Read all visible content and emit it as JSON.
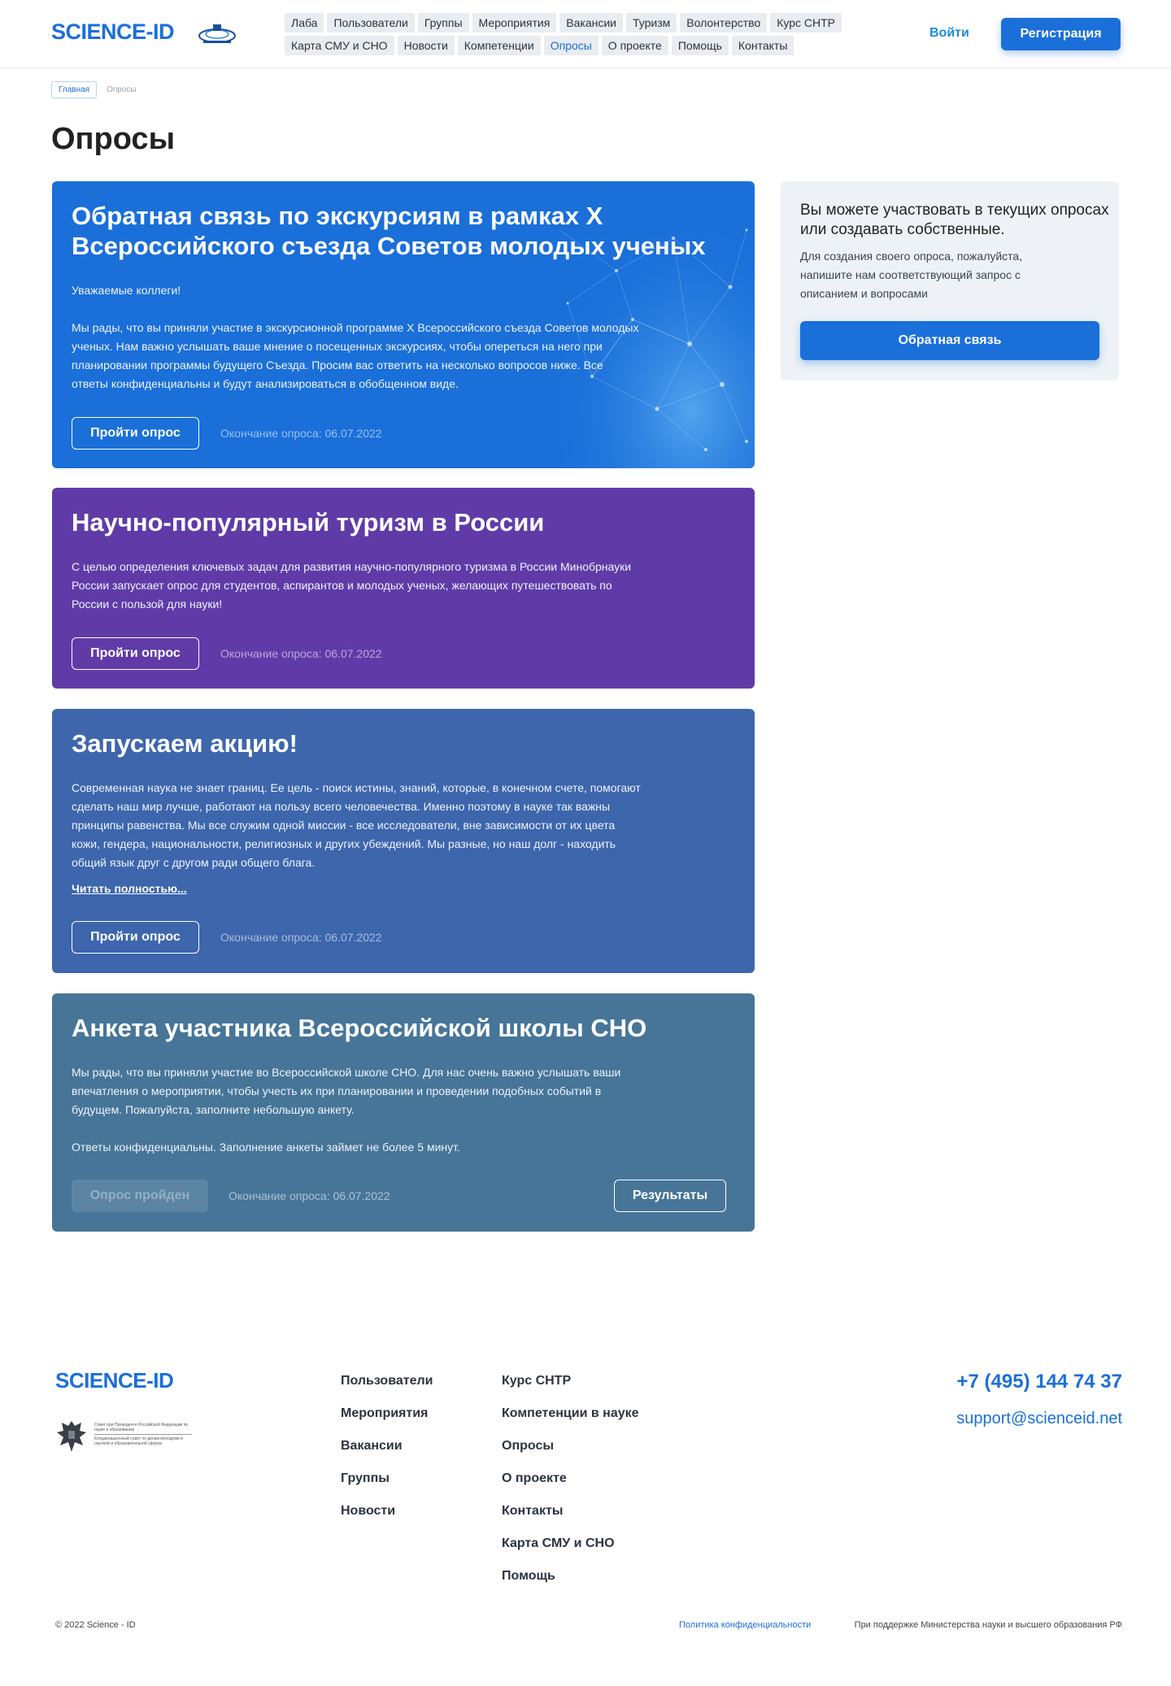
{
  "header": {
    "logo": "SCIENCE-ID",
    "nav": [
      {
        "label": "Лаба",
        "active": false
      },
      {
        "label": "Пользователи",
        "active": false
      },
      {
        "label": "Группы",
        "active": false
      },
      {
        "label": "Мероприятия",
        "active": false
      },
      {
        "label": "Вакансии",
        "active": false
      },
      {
        "label": "Туризм",
        "active": false
      },
      {
        "label": "Волонтерство",
        "active": false
      },
      {
        "label": "Курс СНТР",
        "active": false
      },
      {
        "label": "Карта СМУ и СНО",
        "active": false
      },
      {
        "label": "Новости",
        "active": false
      },
      {
        "label": "Компетенции",
        "active": false
      },
      {
        "label": "Опросы",
        "active": true
      },
      {
        "label": "О проекте",
        "active": false
      },
      {
        "label": "Помощь",
        "active": false
      },
      {
        "label": "Контакты",
        "active": false
      }
    ],
    "login": "Войти",
    "register": "Регистрация"
  },
  "breadcrumb": {
    "home": "Главная",
    "current": "Опросы"
  },
  "page_title": "Опросы",
  "polls": [
    {
      "title": "Обратная связь по экскурсиям в рамках X Всероссийского съезда Советов молодых ученых",
      "paragraphs": [
        "Уважаемые коллеги!",
        "Мы рады, что вы приняли участие в экскурсионной программе X Всероссийского съезда Советов молодых ученых. Нам важно услышать ваше мнение о посещенных экскурсиях, чтобы опереться на него при планировании программы будущего Съезда. Просим вас ответить на несколько вопросов ниже. Все ответы конфиденциальны и будут анализироваться в обобщенном виде."
      ],
      "button": "Пройти опрос",
      "deadline": "Окончание опроса: 06.07.2022",
      "color": "#1a6fd9"
    },
    {
      "title": "Научно-популярный туризм в России",
      "paragraphs": [
        "С целью определения ключевых задач для развития научно-популярного туризма в России Минобрнауки России запускает опрос для студентов, аспирантов и молодых ученых, желающих путешествовать по России с пользой для науки!"
      ],
      "button": "Пройти опрос",
      "deadline": "Окончание опроса: 06.07.2022",
      "color": "#603ba8"
    },
    {
      "title": "Запускаем акцию!",
      "paragraphs": [
        "Современная наука не знает границ. Ее цель - поиск истины, знаний, которые, в конечном счете, помогают сделать наш мир лучше, работают на пользу всего человечества. Именно поэтому в науке так важны принципы равенства. Мы все служим одной миссии - все исследователи, вне зависимости от их цвета кожи, гендера, национальности, религиозных и других убеждений. Мы разные, но наш долг - находить общий язык друг с другом ради общего блага."
      ],
      "read_more": "Читать полностью...",
      "button": "Пройти опрос",
      "deadline": "Окончание опроса: 06.07.2022",
      "color": "#3d66ad"
    },
    {
      "title": "Анкета участника Всероссийской школы СНО",
      "paragraphs": [
        "Мы рады, что вы приняли участие во Всероссийской школе СНО. Для нас очень важно услышать ваши впечатления о мероприятии, чтобы учесть их при планировании и проведении подобных событий в будущем. Пожалуйста, заполните небольшую анкету.",
        "Ответы конфиденциальны. Заполнение анкеты займет не более 5 минут."
      ],
      "button": "Опрос пройден",
      "deadline": "Окончание опроса: 06.07.2022",
      "results": "Результаты",
      "color": "#467598"
    }
  ],
  "sidebar": {
    "title": "Вы можете участвовать в текущих опросах или создавать собственные.",
    "text": "Для создания своего опроса, пожалуйста, напишите нам соответствующий запрос с описанием и вопросами",
    "button": "Обратная связь"
  },
  "footer": {
    "logo": "SCIENCE-ID",
    "emblem_text": "Совет при Президенте Российской Федерации по науке и образованию",
    "emblem_subtext": "Координационный совет по делам молодежи в научной и образовательной сферах",
    "col1": [
      "Пользователи",
      "Мероприятия",
      "Вакансии",
      "Группы",
      "Новости"
    ],
    "col2": [
      "Курс СНТР",
      "Компетенции в науке",
      "Опросы",
      "О проекте",
      "Контакты",
      "Карта СМУ и СНО",
      "Помощь"
    ],
    "phone": "+7 (495) 144 74 37",
    "email": "support@scienceid.net",
    "copyright": "© 2022 Science - ID",
    "privacy": "Политика конфиденциальности",
    "support_text": "При поддержке Министерства науки и высшего образования РФ"
  }
}
